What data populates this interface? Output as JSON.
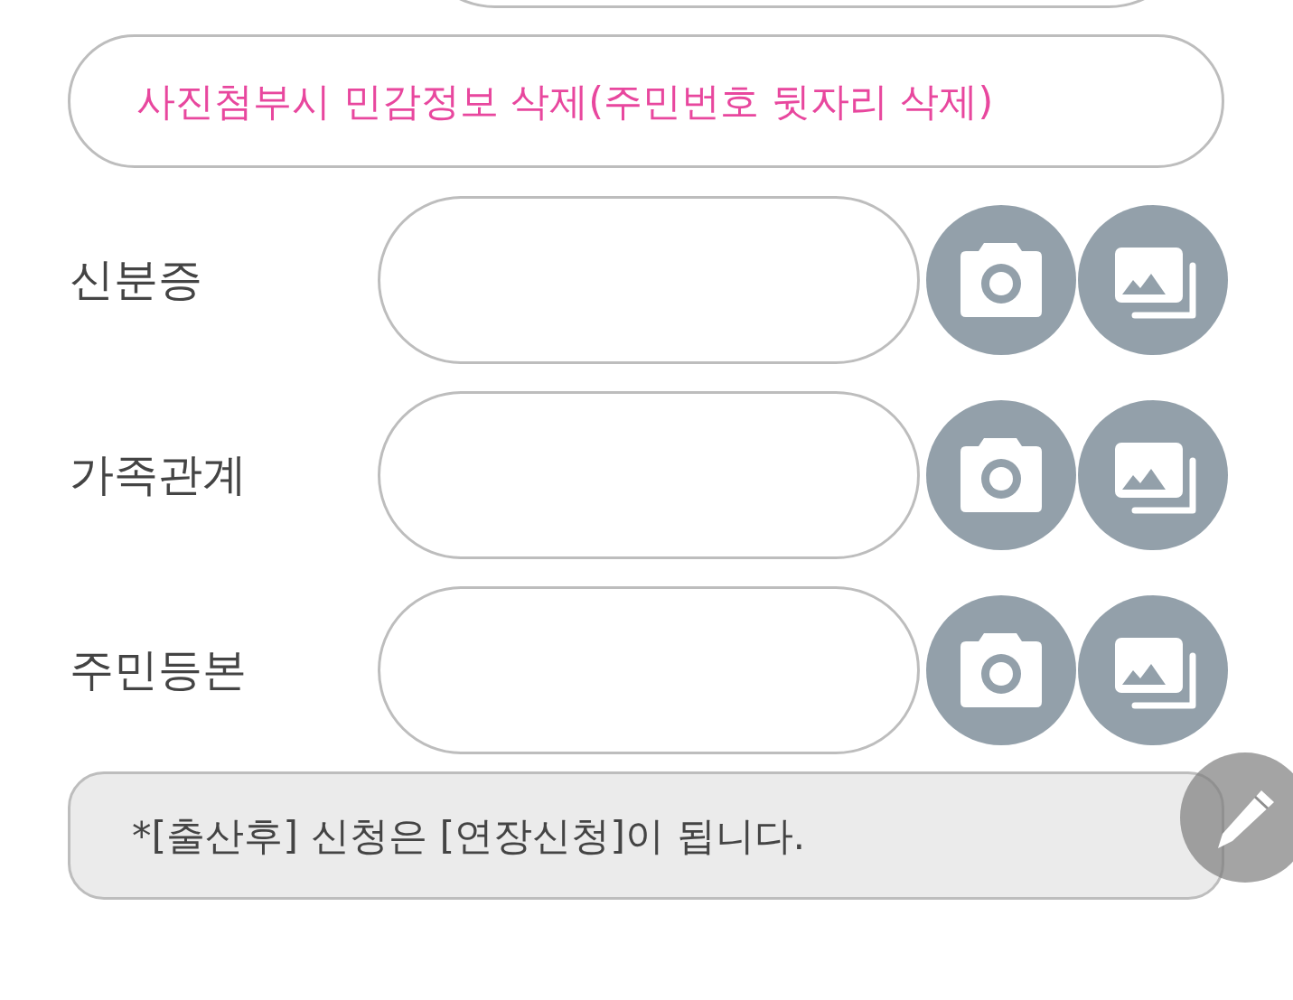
{
  "notice_banner": {
    "text": "사진첨부시 민감정보 삭제(주민번호 뒷자리 삭제)"
  },
  "documents": [
    {
      "label": "신분증"
    },
    {
      "label": "가족관계"
    },
    {
      "label": "주민등본"
    }
  ],
  "footer_note": {
    "text": "*[출산후] 신청은 [연장신청]이 됩니다."
  }
}
